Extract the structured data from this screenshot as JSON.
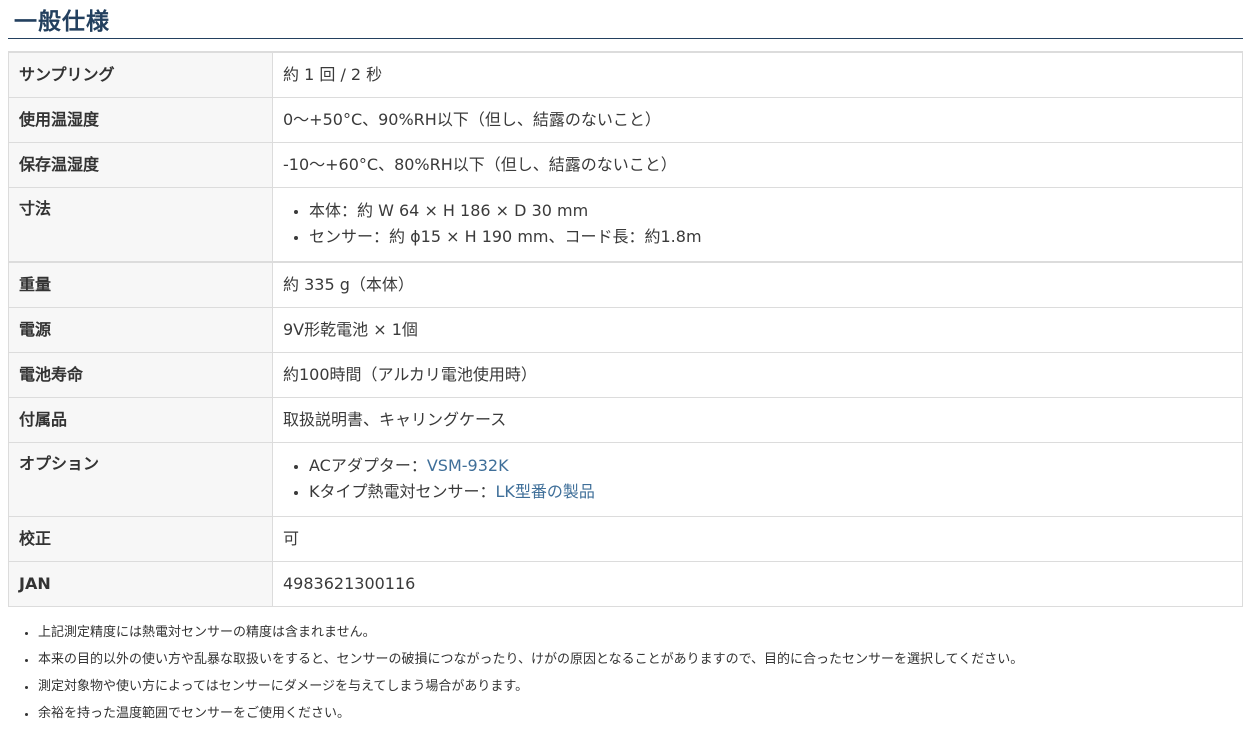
{
  "section": {
    "title": "一般仕様"
  },
  "spec_rows": [
    {
      "label": "サンプリング",
      "value": "約 1 回 / 2 秒"
    },
    {
      "label": "使用温湿度",
      "value": "0～+50°C、90%RH以下（但し、結露のないこと）"
    },
    {
      "label": "保存温湿度",
      "value": "-10～+60°C、80%RH以下（但し、結露のないこと）"
    },
    {
      "label": "寸法",
      "items": [
        "本体：約 W 64 × H 186 × D 30 mm",
        "センサー：約 ϕ15 × H 190 mm、コード長：約1.8m"
      ]
    },
    {
      "label": "重量",
      "value": "約 335 g（本体）"
    },
    {
      "label": "電源",
      "value": "9V形乾電池 × 1個"
    },
    {
      "label": "電池寿命",
      "value": "約100時間（アルカリ電池使用時）"
    },
    {
      "label": "付属品",
      "value": "取扱説明書、キャリングケース"
    },
    {
      "label": "オプション",
      "options": [
        {
          "prefix": "ACアダプター：",
          "link_text": "VSM-932K"
        },
        {
          "prefix": "Kタイプ熱電対センサー：",
          "link_text": "LK型番の製品"
        }
      ]
    },
    {
      "label": "校正",
      "value": "可"
    },
    {
      "label": "JAN",
      "value": "4983621300116"
    }
  ],
  "notes": [
    "上記測定精度には熱電対センサーの精度は含まれません。",
    "本来の目的以外の使い方や乱暴な取扱いをすると、センサーの破損につながったり、けがの原因となることがありますので、目的に合ったセンサーを選択してください。",
    "測定対象物や使い方によってはセンサーにダメージを与えてしまう場合があります。",
    "余裕を持った温度範囲でセンサーをご使用ください。"
  ],
  "colors": {
    "heading": "#23405f",
    "link": "#3f6f99",
    "label_bg": "#f7f7f7",
    "border": "#dcdcdc"
  }
}
